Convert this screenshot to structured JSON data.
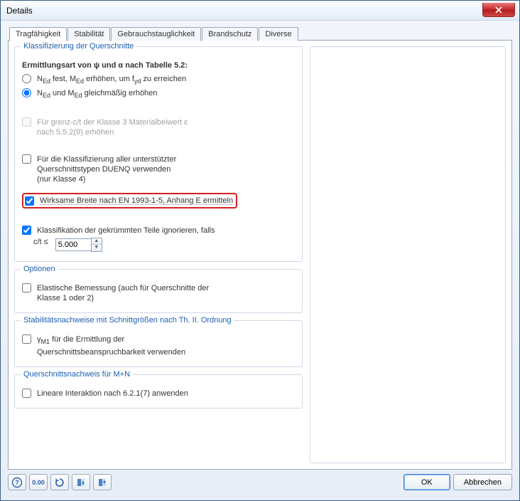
{
  "window": {
    "title": "Details"
  },
  "tabs": {
    "items": [
      {
        "label": "Tragfähigkeit"
      },
      {
        "label": "Stabilität"
      },
      {
        "label": "Gebrauchstauglichkeit"
      },
      {
        "label": "Brandschutz"
      },
      {
        "label": "Diverse"
      }
    ],
    "active": 0
  },
  "group_klass": {
    "legend": "Klassifizierung der Querschnitte",
    "ermittlungsart": "Ermittlungsart von ψ und α nach Tabelle 5.2:",
    "radio1": "N_Ed fest, M_Ed erhöhen, um f_yd zu erreichen",
    "radio2": "N_Ed und M_Ed gleichmäßig erhöhen",
    "chk_grenz_l1": "Für grenz-c/t der Klasse 3 Materialbeiwert ε",
    "chk_grenz_l2": "nach 5.5.2(9) erhöhen",
    "chk_duenq_l1": "Für die Klassifizierung aller unterstützter",
    "chk_duenq_l2": "Querschnittstypen DUENQ verwenden",
    "chk_duenq_l3": "(nur Klasse 4)",
    "chk_breite": "Wirksame Breite nach EN 1993-1-5, Anhang E ermitteln",
    "chk_curved": "Klassifikation der gekrümmten Teile ignorieren, falls",
    "cft_label": "c/t ≤",
    "cft_value": "5.000"
  },
  "group_opt": {
    "legend": "Optionen",
    "chk_elastic_l1": "Elastische Bemessung (auch für Querschnitte der",
    "chk_elastic_l2": "Klasse 1 oder 2)"
  },
  "group_stab": {
    "legend": "Stabilitätsnachweise mit Schnittgrößen nach Th. II. Ordnung",
    "chk_gamma_l1": "γ_M1 für die Ermittlung der",
    "chk_gamma_l2": "Querschnittsbeanspruchbarkeit verwenden"
  },
  "group_mn": {
    "legend": "Querschnittsnachweis für M+N",
    "chk_linear": "Lineare Interaktion nach 6.2.1(7) anwenden"
  },
  "buttons": {
    "ok": "OK",
    "cancel": "Abbrechen"
  }
}
